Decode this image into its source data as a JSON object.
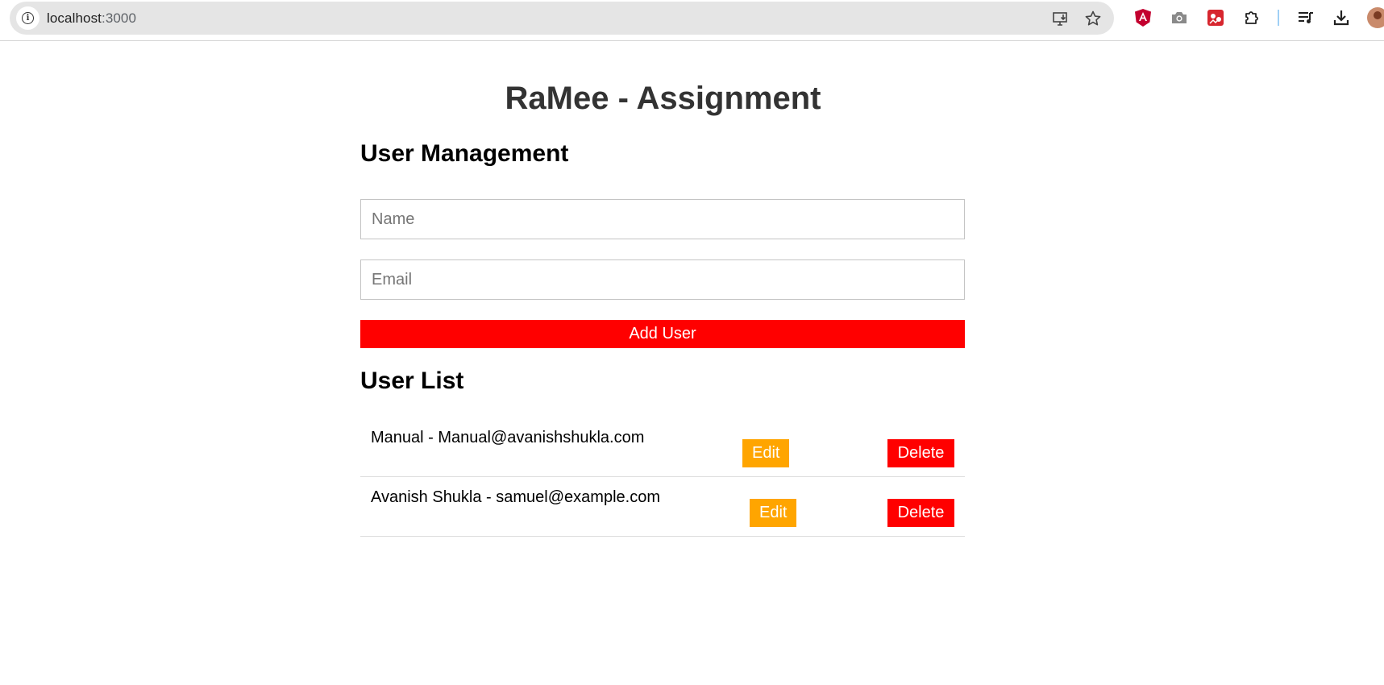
{
  "browser": {
    "url_host": "localhost",
    "url_port": ":3000",
    "toolbar_icons": [
      "install-app-icon",
      "bookmark-star-icon",
      "angular-devtools-icon",
      "screenshot-camera-icon",
      "extension-red-icon",
      "extensions-puzzle-icon",
      "media-queue-icon",
      "downloads-icon",
      "profile-avatar"
    ]
  },
  "page": {
    "title": "RaMee - Assignment",
    "management_heading": "User Management",
    "name_placeholder": "Name",
    "email_placeholder": "Email",
    "add_button": "Add User",
    "list_heading": "User List",
    "users": [
      {
        "text": "Manual - Manual@avanishshukla.com",
        "edit_label": "Edit",
        "delete_label": "Delete"
      },
      {
        "text": "Avanish Shukla - samuel@example.com",
        "edit_label": "Edit",
        "delete_label": "Delete"
      }
    ]
  },
  "colors": {
    "primary_red": "#ff0000",
    "edit_orange": "#ffa500",
    "title_text": "#333333"
  }
}
